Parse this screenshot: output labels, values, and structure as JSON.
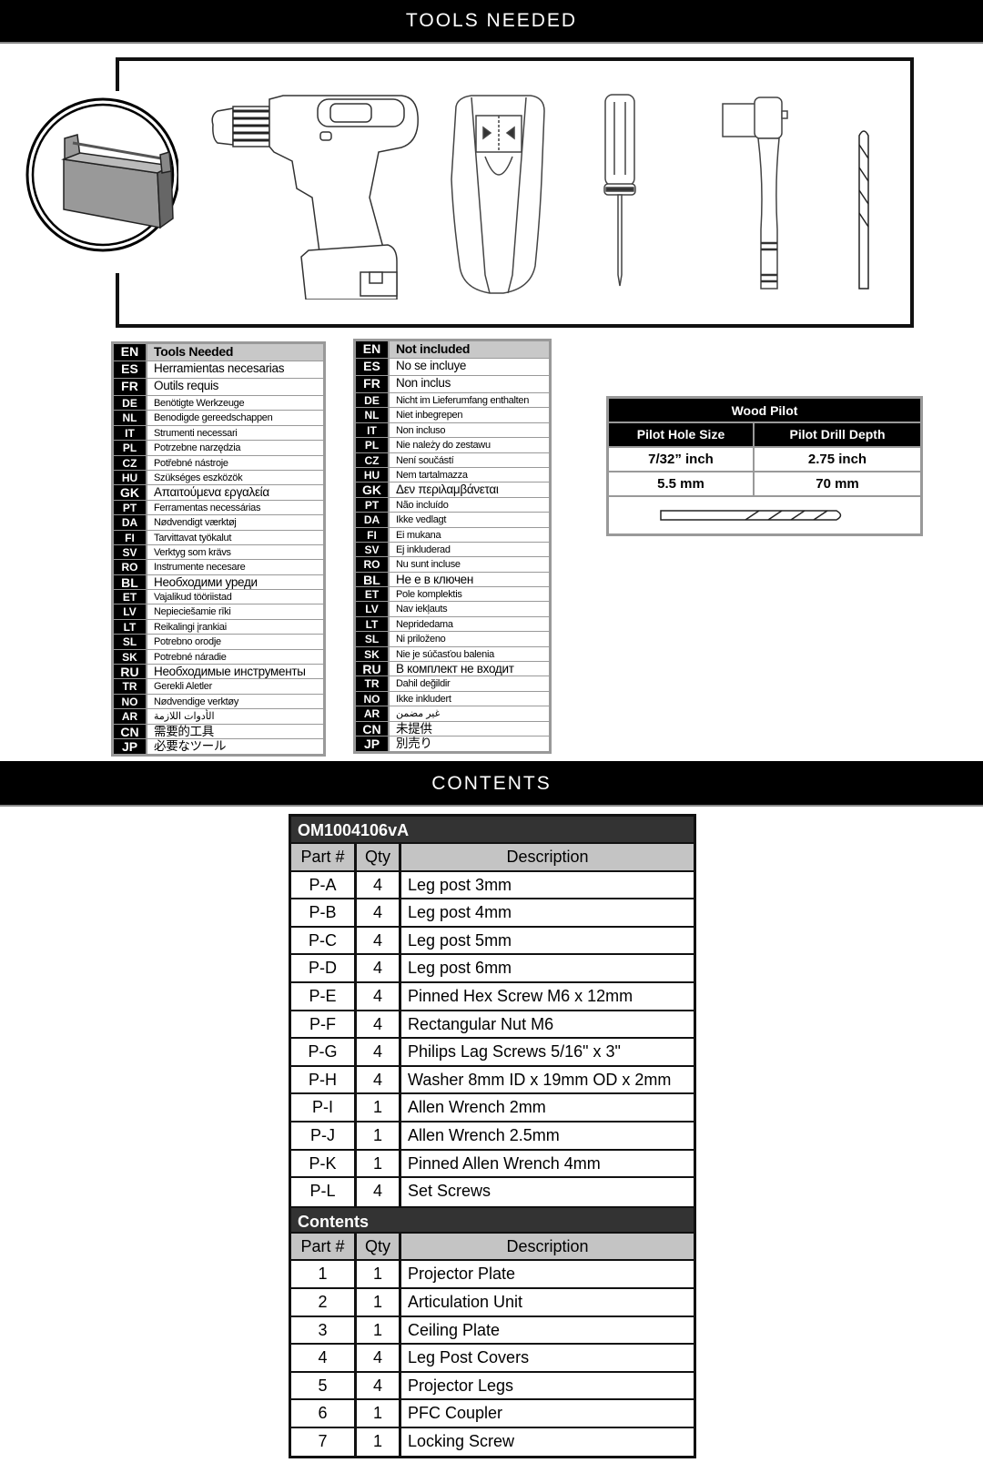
{
  "banners": {
    "tools_needed": "TOOLS NEEDED",
    "contents": "CONTENTS"
  },
  "tools_illustration": {
    "icons": [
      "toolbox-icon",
      "cordless-drill-icon",
      "stud-finder-icon",
      "phillips-screwdriver-icon",
      "ratchet-wrench-icon",
      "drill-bit-icon"
    ]
  },
  "tools_needed_table": {
    "rows": [
      {
        "code": "EN",
        "text": "Tools Needed"
      },
      {
        "code": "ES",
        "text": "Herramientas necesarias"
      },
      {
        "code": "FR",
        "text": "Outils requis"
      },
      {
        "code": "DE",
        "text": "Benötigte Werkzeuge"
      },
      {
        "code": "NL",
        "text": "Benodigde gereedschappen"
      },
      {
        "code": "IT",
        "text": "Strumenti necessari"
      },
      {
        "code": "PL",
        "text": "Potrzebne narzędzia"
      },
      {
        "code": "CZ",
        "text": "Potřebné nástroje"
      },
      {
        "code": "HU",
        "text": "Szükséges eszközök"
      },
      {
        "code": "GK",
        "text": "Απαιτούμενα εργαλεία"
      },
      {
        "code": "PT",
        "text": "Ferramentas necessárias"
      },
      {
        "code": "DA",
        "text": "Nødvendigt værktøj"
      },
      {
        "code": "FI",
        "text": "Tarvittavat työkalut"
      },
      {
        "code": "SV",
        "text": "Verktyg som krävs"
      },
      {
        "code": "RO",
        "text": "Instrumente necesare"
      },
      {
        "code": "BL",
        "text": "Необходими уреди"
      },
      {
        "code": "ET",
        "text": "Vajalikud tööriistad"
      },
      {
        "code": "LV",
        "text": "Nepieciešamie rīki"
      },
      {
        "code": "LT",
        "text": "Reikalingi įrankiai"
      },
      {
        "code": "SL",
        "text": "Potrebno orodje"
      },
      {
        "code": "SK",
        "text": "Potrebné náradie"
      },
      {
        "code": "RU",
        "text": "Необходимые инструменты"
      },
      {
        "code": "TR",
        "text": "Gerekli Aletler"
      },
      {
        "code": "NO",
        "text": "Nødvendige verktøy"
      },
      {
        "code": "AR",
        "text": "الأدوات اللازمة"
      },
      {
        "code": "CN",
        "text": "需要的工具"
      },
      {
        "code": "JP",
        "text": "必要なツール"
      }
    ]
  },
  "not_included_table": {
    "rows": [
      {
        "code": "EN",
        "text": "Not included"
      },
      {
        "code": "ES",
        "text": "No se incluye"
      },
      {
        "code": "FR",
        "text": "Non inclus"
      },
      {
        "code": "DE",
        "text": "Nicht im Lieferumfang enthalten"
      },
      {
        "code": "NL",
        "text": "Niet inbegrepen"
      },
      {
        "code": "IT",
        "text": "Non incluso"
      },
      {
        "code": "PL",
        "text": "Nie należy do zestawu"
      },
      {
        "code": "CZ",
        "text": "Není součástí"
      },
      {
        "code": "HU",
        "text": "Nem tartalmazza"
      },
      {
        "code": "GK",
        "text": "Δεν περιλαμβάνεται"
      },
      {
        "code": "PT",
        "text": "Não incluído"
      },
      {
        "code": "DA",
        "text": "Ikke vedlagt"
      },
      {
        "code": "FI",
        "text": "Ei mukana"
      },
      {
        "code": "SV",
        "text": "Ej inkluderad"
      },
      {
        "code": "RO",
        "text": "Nu sunt incluse"
      },
      {
        "code": "BL",
        "text": "Не е в ключен"
      },
      {
        "code": "ET",
        "text": "Pole komplektis"
      },
      {
        "code": "LV",
        "text": "Nav iekļauts"
      },
      {
        "code": "LT",
        "text": "Nepridedama"
      },
      {
        "code": "SL",
        "text": "Ni priloženo"
      },
      {
        "code": "SK",
        "text": "Nie je súčasťou balenia"
      },
      {
        "code": "RU",
        "text": "В комплект не входит"
      },
      {
        "code": "TR",
        "text": "Dahil değildir"
      },
      {
        "code": "NO",
        "text": "Ikke inkludert"
      },
      {
        "code": "AR",
        "text": "غير مضمن"
      },
      {
        "code": "CN",
        "text": "未提供"
      },
      {
        "code": "JP",
        "text": "別売り"
      }
    ]
  },
  "wood_pilot": {
    "title": "Wood Pilot",
    "headers": [
      "Pilot Hole Size",
      "Pilot Drill Depth"
    ],
    "rows": [
      [
        "7/32” inch",
        "2.75 inch"
      ],
      [
        "5.5 mm",
        "70 mm"
      ]
    ],
    "image_icon": "drill-bit-icon"
  },
  "contents_table": {
    "hardware_title": "OM1004106vA",
    "headers": {
      "part": "Part #",
      "qty": "Qty",
      "desc": "Description"
    },
    "hardware_rows": [
      {
        "part": "P-A",
        "qty": "4",
        "desc": "Leg post 3mm"
      },
      {
        "part": "P-B",
        "qty": "4",
        "desc": "Leg post 4mm"
      },
      {
        "part": "P-C",
        "qty": "4",
        "desc": "Leg post 5mm"
      },
      {
        "part": "P-D",
        "qty": "4",
        "desc": "Leg post 6mm"
      },
      {
        "part": "P-E",
        "qty": "4",
        "desc": "Pinned Hex Screw M6 x 12mm"
      },
      {
        "part": "P-F",
        "qty": "4",
        "desc": "Rectangular Nut M6"
      },
      {
        "part": "P-G",
        "qty": "4",
        "desc": "Philips Lag Screws 5/16\" x 3\""
      },
      {
        "part": "P-H",
        "qty": "4",
        "desc": "Washer 8mm ID x 19mm OD x 2mm"
      },
      {
        "part": "P-I",
        "qty": "1",
        "desc": "Allen Wrench 2mm"
      },
      {
        "part": "P-J",
        "qty": "1",
        "desc": "Allen Wrench 2.5mm"
      },
      {
        "part": "P-K",
        "qty": "1",
        "desc": "Pinned Allen Wrench 4mm"
      },
      {
        "part": "P-L",
        "qty": "4",
        "desc": "Set Screws"
      }
    ],
    "contents_title": "Contents",
    "contents_rows": [
      {
        "part": "1",
        "qty": "1",
        "desc": "Projector Plate"
      },
      {
        "part": "2",
        "qty": "1",
        "desc": "Articulation Unit"
      },
      {
        "part": "3",
        "qty": "1",
        "desc": "Ceiling Plate"
      },
      {
        "part": "4",
        "qty": "4",
        "desc": "Leg Post Covers"
      },
      {
        "part": "5",
        "qty": "4",
        "desc": "Projector Legs"
      },
      {
        "part": "6",
        "qty": "1",
        "desc": "PFC Coupler"
      },
      {
        "part": "7",
        "qty": "1",
        "desc": "Locking Screw"
      }
    ]
  }
}
